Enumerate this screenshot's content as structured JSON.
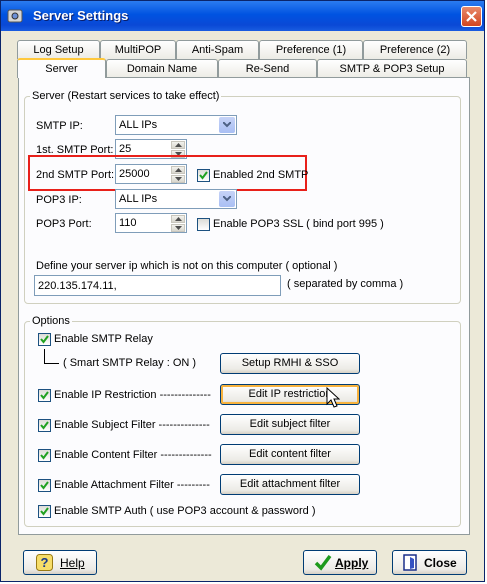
{
  "window": {
    "title": "Server Settings",
    "title_icon": "gear-app-icon"
  },
  "tabs_row1": [
    "Log Setup",
    "MultiPOP",
    "Anti-Spam",
    "Preference (1)",
    "Preference (2)"
  ],
  "tabs_row2": [
    "Server",
    "Domain Name",
    "Re-Send",
    "SMTP & POP3 Setup"
  ],
  "active_tab": "Server",
  "server_group": {
    "label": "Server (Restart services to take effect)",
    "smtp_ip_label": "SMTP IP:",
    "smtp_ip_value": "ALL IPs",
    "smtp_port1_label": "1st. SMTP Port:",
    "smtp_port1_value": "25",
    "smtp_port2_label": "2nd SMTP Port:",
    "smtp_port2_value": "25000",
    "enabled_2nd_smtp_label": "Enabled 2nd SMTP",
    "enabled_2nd_smtp_checked": true,
    "pop3_ip_label": "POP3 IP:",
    "pop3_ip_value": "ALL IPs",
    "pop3_port_label": "POP3 Port:",
    "pop3_port_value": "110",
    "pop3_ssl_label": "Enable POP3 SSL ( bind port 995 )",
    "pop3_ssl_checked": false,
    "define_ip_label": "Define your server ip which is not on this computer ( optional )",
    "define_ip_value": "220.135.174.11,",
    "separated_label": "( separated by comma )"
  },
  "options_group": {
    "label": "Options",
    "smtp_relay_label": "Enable SMTP Relay",
    "smtp_relay_checked": true,
    "smart_relay_status": "( Smart SMTP Relay : ON )",
    "setup_rmhi_button": "Setup RMHI & SSO",
    "ip_restriction_label": "Enable IP Restriction --------------",
    "ip_restriction_checked": true,
    "edit_ip_button": "Edit IP restriction",
    "subject_filter_label": "Enable Subject Filter --------------",
    "subject_filter_checked": true,
    "edit_subject_button": "Edit subject filter",
    "content_filter_label": "Enable Content Filter --------------",
    "content_filter_checked": true,
    "edit_content_button": "Edit content filter",
    "attachment_filter_label": "Enable Attachment Filter   ---------",
    "attachment_filter_checked": true,
    "edit_attachment_button": "Edit attachment filter",
    "smtp_auth_label": "Enable SMTP Auth ( use POP3 account & password )",
    "smtp_auth_checked": true
  },
  "footer": {
    "help_button": "Help",
    "apply_button": "Apply",
    "close_button": "Close"
  }
}
